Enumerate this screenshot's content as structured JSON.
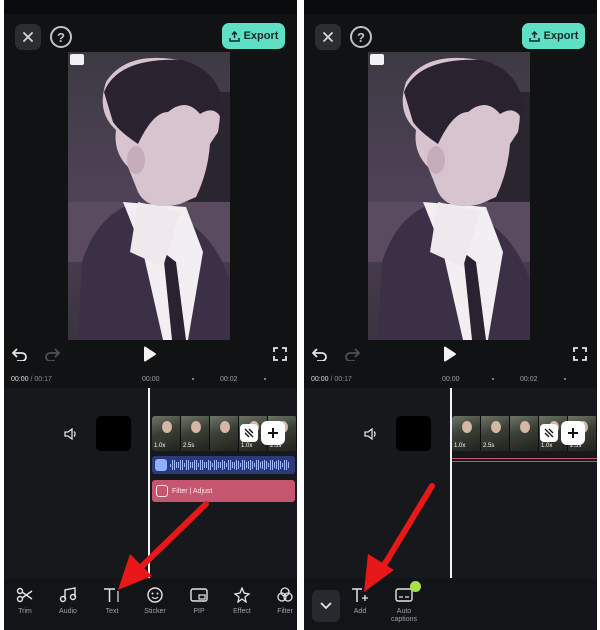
{
  "colors": {
    "panel_bg": "#101214",
    "accent_export": "#5fe0c4",
    "audio_track": "#2b3a7a",
    "filter_track": "#c4566f",
    "arrow": "#e8181a",
    "autocaption_badge": "#a6e34a"
  },
  "left": {
    "close_icon": "close-icon",
    "help_icon": "help-icon",
    "export_label": "Export",
    "time_current": "00:00",
    "time_total": "/ 00:17",
    "ruler_labels": [
      "00:00",
      "00:02"
    ],
    "clip_labels": [
      "1.0x",
      "2.5s",
      "1.0x",
      "2.5s"
    ],
    "filter_label": "Filter | Adjust",
    "tools": [
      {
        "label": "Trim",
        "icon": "scissors-icon"
      },
      {
        "label": "Audio",
        "icon": "music-note-icon"
      },
      {
        "label": "Text",
        "icon": "text-icon"
      },
      {
        "label": "Sticker",
        "icon": "sticker-icon"
      },
      {
        "label": "PIP",
        "icon": "pip-icon"
      },
      {
        "label": "Effect",
        "icon": "effect-icon"
      },
      {
        "label": "Filter",
        "icon": "filter-icon"
      }
    ]
  },
  "right": {
    "export_label": "Export",
    "time_current": "00:00",
    "time_total": "/ 00:17",
    "ruler_labels": [
      "00:00",
      "00:02"
    ],
    "clip_labels": [
      "1.0x",
      "2.5s",
      "1.0x",
      "2.5s"
    ],
    "tools": [
      {
        "label": "Add",
        "icon": "text-add-icon"
      },
      {
        "label": "Auto\ncaptions",
        "icon": "auto-captions-icon"
      }
    ]
  }
}
